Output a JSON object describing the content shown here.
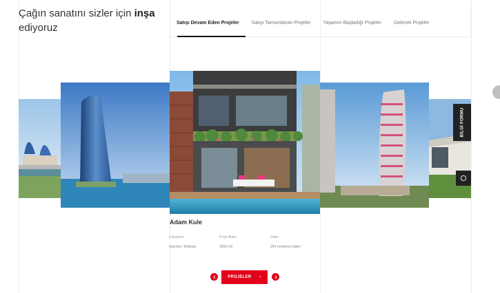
{
  "headline": {
    "text": "Çağın sanatını sizler için ",
    "bold": "inşa",
    "line2": "ediyoruz"
  },
  "tabs": [
    {
      "label": "Satışı Devam Eden Projeler"
    },
    {
      "label": "Satışı Tamamlanan Projeler"
    },
    {
      "label": "Yaşamın Başladığı Projeler"
    },
    {
      "label": "Gelecek Projeler"
    }
  ],
  "side": {
    "form_label": "BİLGİ FORMU",
    "whatsapp_icon": "whatsapp-icon"
  },
  "project": {
    "name": "Adam Kule",
    "location_label": "Lokasyon",
    "location_value": "İstanbul / Maltepe",
    "area_label": "Proje Alanı",
    "area_value": "3000 m2",
    "units_label": "Daire",
    "units_value": "254 residence daire"
  },
  "cta": {
    "label": "PROJELER",
    "arrow": "›",
    "prev_icon": "chevron-left-icon",
    "next_icon": "chevron-right-icon"
  },
  "colors": {
    "accent": "#e3001b",
    "dark": "#222222"
  }
}
